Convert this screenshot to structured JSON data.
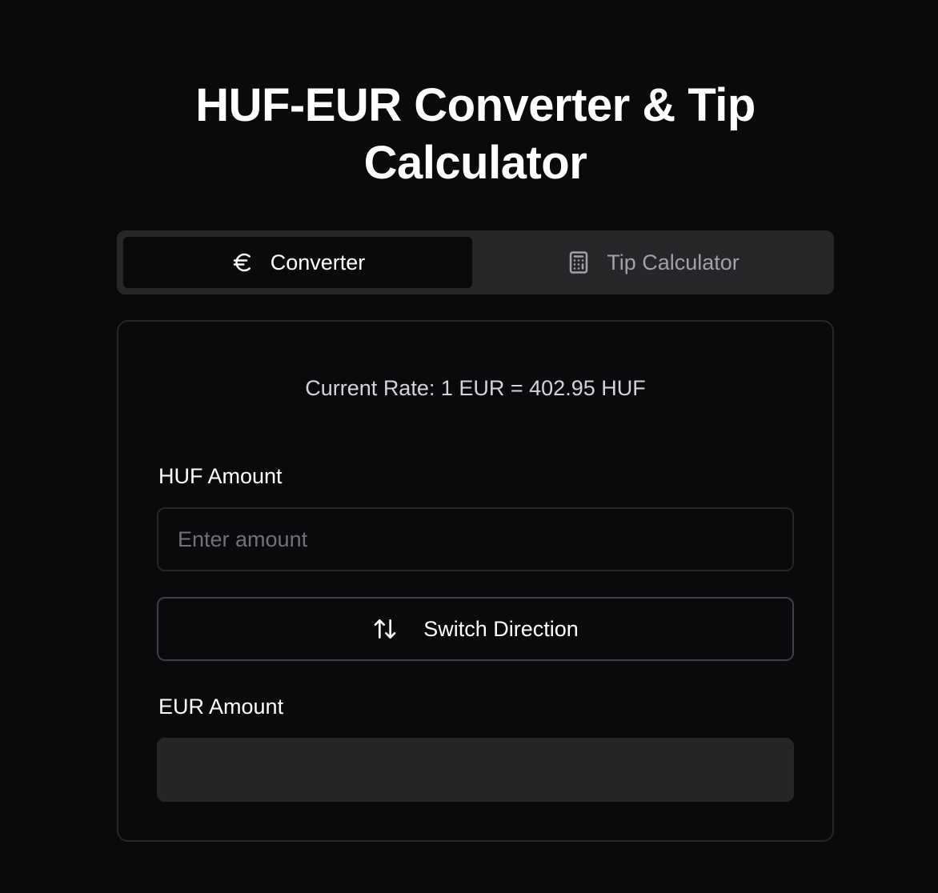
{
  "header": {
    "title": "HUF-EUR Converter & Tip Calculator"
  },
  "tabs": [
    {
      "label": "Converter",
      "icon": "euro-icon",
      "active": true
    },
    {
      "label": "Tip Calculator",
      "icon": "calculator-icon",
      "active": false
    }
  ],
  "converter": {
    "rate_text": "Current Rate: 1 EUR = 402.95 HUF",
    "from_label": "HUF Amount",
    "from_placeholder": "Enter amount",
    "from_value": "",
    "switch_label": "Switch Direction",
    "switch_icon": "arrows-up-down-icon",
    "to_label": "EUR Amount",
    "to_value": ""
  },
  "colors": {
    "background": "#0a0a0c",
    "tab_bar": "#27272a",
    "border": "#27272a",
    "readonly_field": "#252528",
    "muted_text": "#a1a1aa"
  }
}
